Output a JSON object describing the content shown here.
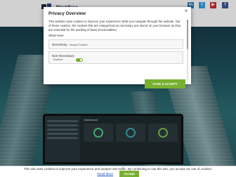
{
  "site": {
    "logo_text": "BlockBase",
    "social_icons": [
      "linkedin-icon",
      "twitter-icon",
      "youtube-icon",
      "facebook-icon"
    ]
  },
  "dashboard": {
    "title": "Dashboard"
  },
  "privacy_modal": {
    "title": "Privacy Overview",
    "close_label": "×",
    "description": "This website uses cookies to improve your experience while you navigate through the website. Out of these cookies, the cookies that are categorized as necessary are stored on your browser as they are essential for the working of basic functionalities",
    "show_more": "Show more",
    "categories": [
      {
        "name": "Necessary",
        "status": "Always Enabled"
      },
      {
        "name": "Non-Necessary",
        "status": "Enabled"
      }
    ],
    "save_label": "SAVE & ACCEPT"
  },
  "cookie_bar": {
    "text": "This site uses cookies to improve your experience and analyze site traffic. By continuing to use this site, you accept our use of cookies.",
    "read_more": "Read More",
    "accept_label": "Accept"
  },
  "colors": {
    "accent_green": "#78b030",
    "hero_teal": "#1f5561",
    "link_blue": "#1a55b8"
  }
}
